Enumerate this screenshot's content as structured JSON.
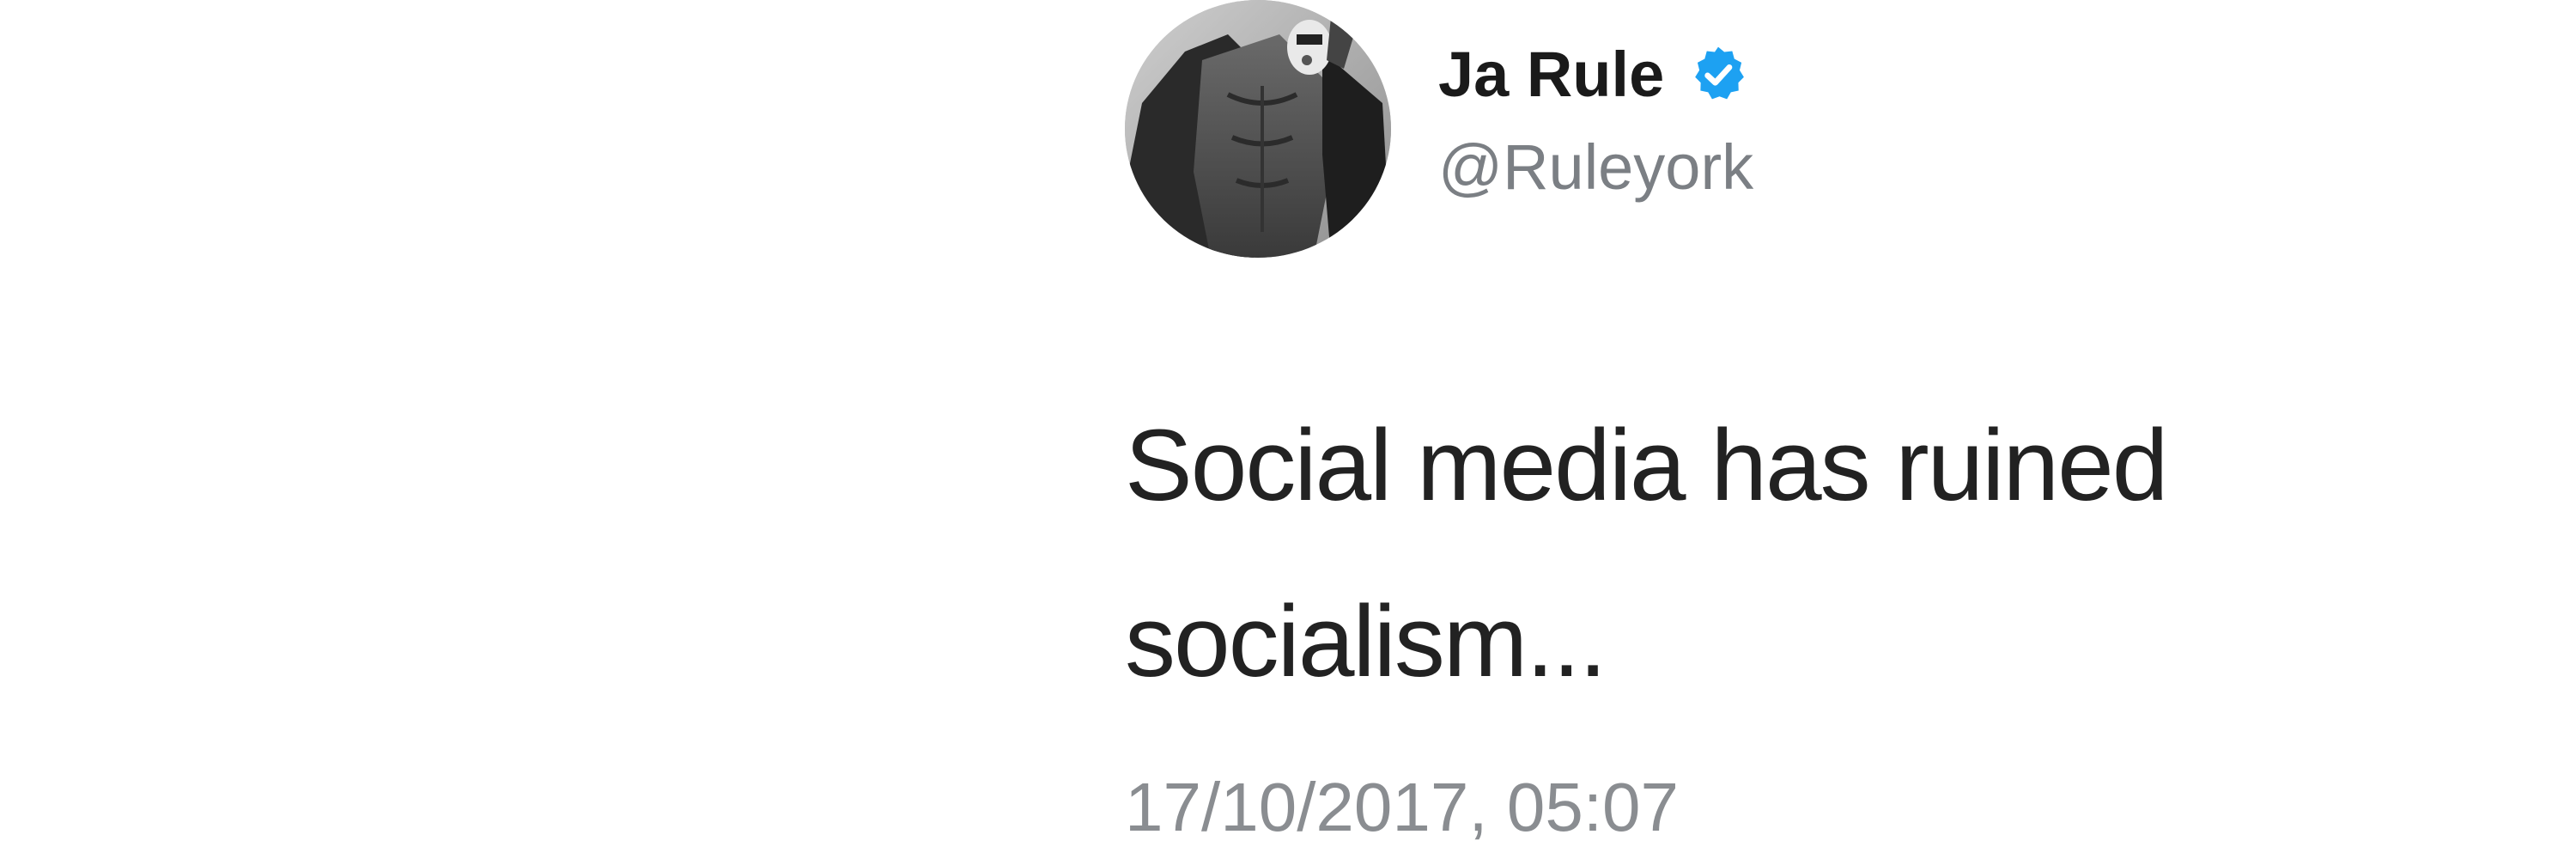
{
  "tweet": {
    "author": {
      "display_name": "Ja Rule",
      "handle": "@Ruleyork",
      "verified": true,
      "avatar_icon": "profile-photo-avatar"
    },
    "text": "Social media has ruined\nsocialism...",
    "timestamp": "17/10/2017, 05:07"
  },
  "colors": {
    "verified_badge": "#1da1f2",
    "name": "#1a1a1a",
    "handle": "#7b7f84",
    "text": "#222222",
    "timestamp": "#8a8d91"
  }
}
